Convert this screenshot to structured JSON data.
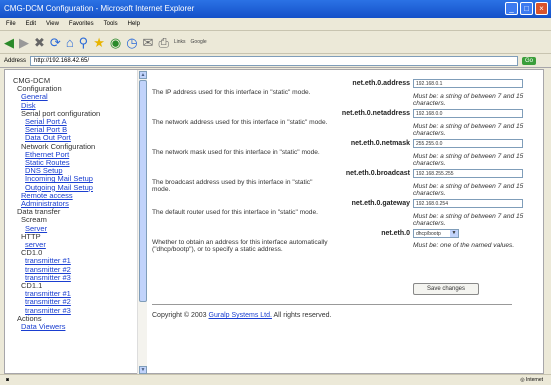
{
  "window": {
    "title": "CMG-DCM Configuration - Microsoft Internet Explorer"
  },
  "menu": [
    "File",
    "Edit",
    "View",
    "Favorites",
    "Tools",
    "Help"
  ],
  "toolbar": {
    "links": "Links",
    "google": "Google"
  },
  "address": {
    "label": "Address",
    "url": "http://192.168.42.65/",
    "go": "Go"
  },
  "nav": {
    "title": "CMG-DCM",
    "configuration": "Configuration",
    "general": "General",
    "disk": "Disk",
    "serial_port_config": "Serial port configuration",
    "serial_port_a": "Serial Port A",
    "serial_port_b": "Serial Port B",
    "data_out_port": "Data Out Port",
    "network_config": "Network Configuration",
    "ethernet_port": "Ethernet Port",
    "static_routes": "Static Routes",
    "dns_setup": "DNS Setup",
    "incoming_mail": "Incoming Mail Setup",
    "outgoing_mail": "Outgoing Mail Setup",
    "remote_access": "Remote access",
    "administrators": "Administrators",
    "data_transfer": "Data transfer",
    "scream": "Scream",
    "server": "Server",
    "http": "HTTP",
    "http_server": "server",
    "cd10": "CD1.0",
    "cd10_t1": "transmitter #1",
    "cd10_t2": "transmitter #2",
    "cd10_t3": "transmitter #3",
    "cd11": "CD1.1",
    "cd11_t1": "transmitter #1",
    "cd11_t2": "transmitter #2",
    "cd11_t3": "transmitter #3",
    "actions": "Actions",
    "data_viewers": "Data Viewers"
  },
  "fields": {
    "address": {
      "name": "net.eth.0.address",
      "value": "192.168.0.1",
      "desc": "The IP address used for this interface in \"static\" mode.",
      "valid": "Must be: a string of between 7 and 15 characters."
    },
    "netaddress": {
      "name": "net.eth.0.netaddress",
      "value": "192.168.0.0",
      "desc": "The network address used for this interface in \"static\" mode.",
      "valid": "Must be: a string of between 7 and 15 characters."
    },
    "netmask": {
      "name": "net.eth.0.netmask",
      "value": "255.255.0.0",
      "desc": "The network mask used for this interface in \"static\" mode.",
      "valid": "Must be: a string of between 7 and 15 characters."
    },
    "broadcast": {
      "name": "net.eth.0.broadcast",
      "value": "192.168.255.255",
      "desc": "The broadcast address used by this interface in \"static\" mode.",
      "valid": "Must be: a string of between 7 and 15 characters."
    },
    "gateway": {
      "name": "net.eth.0.gateway",
      "value": "192.168.0.254",
      "desc": "The default router used for this interface in \"static\" mode.",
      "valid": "Must be: a string of between 7 and 15 characters."
    },
    "mode": {
      "name": "net.eth.0",
      "value": "dhcp/bootp",
      "desc": "Whether to obtain an address for this interface automatically (\"dhcp/bootp\"), or to specify a static address.",
      "valid": "Must be: one of the named values."
    }
  },
  "save_label": "Save changes",
  "copyright": {
    "prefix": "Copyright © 2003 ",
    "link": "Guralp Systems Ltd.",
    "suffix": " All rights reserved."
  },
  "status": {
    "zone": "Internet"
  },
  "colors": {
    "titlebar": "#1450c8",
    "link": "#1a3ed0"
  }
}
